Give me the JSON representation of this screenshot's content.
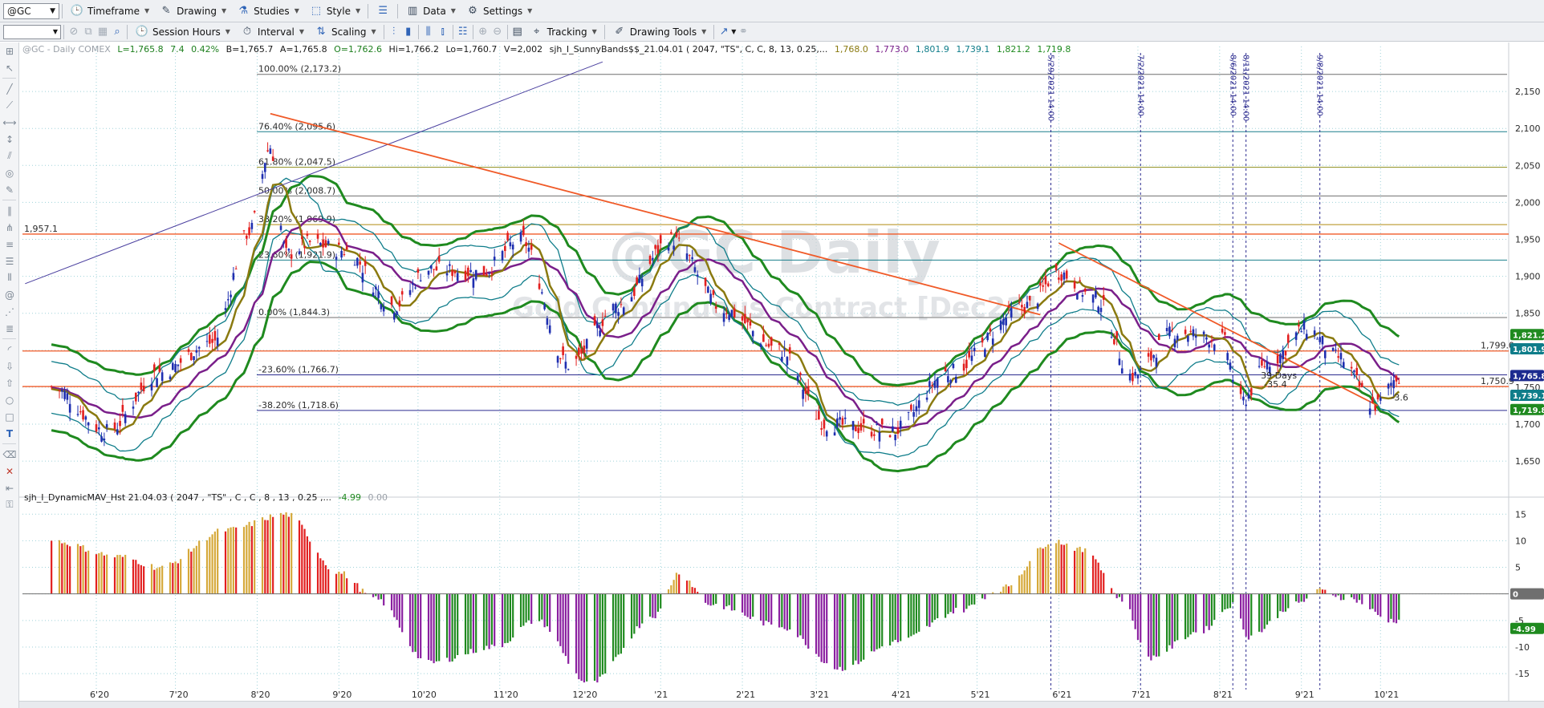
{
  "toolbar": {
    "symbol": "@GC",
    "timeframe": "Timeframe",
    "drawing": "Drawing",
    "studies": "Studies",
    "style": "Style",
    "data": "Data",
    "settings": "Settings",
    "session_hours": "Session Hours",
    "interval": "Interval",
    "scaling": "Scaling",
    "tracking": "Tracking",
    "drawing_tools": "Drawing Tools"
  },
  "legend": {
    "header": "@GC - Daily  COMEX",
    "L": "L=1,765.8",
    "chg": "7.4",
    "pct": "0.42%",
    "B": "B=1,765.7",
    "A": "A=1,765.8",
    "O": "O=1,762.6",
    "Hi": "Hi=1,766.2",
    "Lo": "Lo=1,760.7",
    "V": "V=2,002",
    "study": "sjh_I_SunnyBands$$_21.04.01 (  2047, \"TS\",  C,  C,    8,  13,  0.25,...",
    "v1": "1,768.0",
    "v2": "1,773.0",
    "v3": "1,801.9",
    "v4": "1,739.1",
    "v5": "1,821.2",
    "v6": "1,719.8"
  },
  "watermark": {
    "line1": "@GC Daily",
    "line2": "Gold Continuous Contract [Dec21]"
  },
  "fib_labels": [
    {
      "text": "100.00% (2,173.2)",
      "color": "#6f6f6f",
      "price": 2173.2
    },
    {
      "text": "76.40% (2,095.6)",
      "color": "#1a7f8c",
      "price": 2095.6
    },
    {
      "text": "61.80% (2,047.5)",
      "color": "#8c8c1a",
      "price": 2047.5
    },
    {
      "text": "50.00% (2,008.7)",
      "color": "#6f6f6f",
      "price": 2008.7
    },
    {
      "text": "38.20% (1,969.9)",
      "color": "#b08a12",
      "price": 1969.9
    },
    {
      "text": "23.60% (1,921.9)",
      "color": "#1a7f8c",
      "price": 1921.9
    },
    {
      "text": "0.00% (1,844.3)",
      "color": "#6f6f6f",
      "price": 1844.3
    },
    {
      "text": "-23.60% (1,766.7)",
      "color": "#2b2b8f",
      "price": 1766.7
    },
    {
      "text": "-38.20% (1,718.6)",
      "color": "#2b2b8f",
      "price": 1718.6
    }
  ],
  "hlines": [
    {
      "label": "1,957.1",
      "price": 1957.1,
      "color": "#f05a28"
    },
    {
      "label": "1,799.0",
      "price": 1799.0,
      "color": "#f05a28"
    },
    {
      "label": "1,750.9",
      "price": 1750.9,
      "color": "#f05a28"
    }
  ],
  "vlines": [
    {
      "label": "5/29/2021 14:00",
      "date": "2021-05-29"
    },
    {
      "label": "7/2/2021 14:00",
      "date": "2021-07-02"
    },
    {
      "label": "8/6/2021 14:00",
      "date": "2021-08-06"
    },
    {
      "label": "8/11/2021 14:00",
      "date": "2021-08-11"
    },
    {
      "label": "9/8/2021 14:00",
      "date": "2021-09-08"
    }
  ],
  "annotations": {
    "days": "39 Days",
    "delta": "-35.4",
    "delta2": "-3.6"
  },
  "price_tags": [
    {
      "text": "1,821.2",
      "price": 1821.2,
      "color": "#1f8a1f"
    },
    {
      "text": "1,801.9",
      "price": 1801.9,
      "color": "#0f7d8a"
    },
    {
      "text": "1,765.8",
      "price": 1765.8,
      "color": "#1c2b8f"
    },
    {
      "text": "1,739.1",
      "price": 1739.1,
      "color": "#0f7d8a"
    },
    {
      "text": "1,719.8",
      "price": 1719.8,
      "color": "#1f8a1f"
    }
  ],
  "osc": {
    "title": "sjh_I_DynamicMAV_Hst 21.04.03 ( 2047 , \"TS\" , C , C ,  8 , 13 , 0.25 ,...",
    "value": "-4.99",
    "value2": "0.00",
    "tag_zero": "0",
    "tag_val": "-4.99"
  },
  "chart_data": {
    "type": "candlestick",
    "title": "@GC Daily",
    "price_axis": {
      "ylim": [
        1610,
        2200
      ],
      "ticks": [
        "2,150",
        "2,100",
        "2,050",
        "2,000",
        "1,950",
        "1,900",
        "1,850",
        "1,800",
        "1,750",
        "1,700",
        "1,650"
      ]
    },
    "osc_axis": {
      "ylim": [
        -18,
        17
      ],
      "ticks": [
        "15",
        "10",
        "5",
        "0",
        "-5",
        "-10",
        "-15"
      ]
    },
    "x_ticks": [
      "6'20",
      "7'20",
      "8'20",
      "9'20",
      "10'20",
      "11'20",
      "12'20",
      "'21",
      "2'21",
      "3'21",
      "4'21",
      "5'21",
      "6'21",
      "7'21",
      "8'21",
      "9'21",
      "10'21"
    ],
    "price_path_anchors": [
      [
        "2020-05-15",
        1750
      ],
      [
        "2020-06-05",
        1690
      ],
      [
        "2020-06-25",
        1770
      ],
      [
        "2020-07-15",
        1810
      ],
      [
        "2020-07-29",
        1960
      ],
      [
        "2020-08-06",
        2075
      ],
      [
        "2020-08-12",
        1930
      ],
      [
        "2020-08-21",
        1945
      ],
      [
        "2020-09-03",
        1935
      ],
      [
        "2020-09-22",
        1860
      ],
      [
        "2020-10-05",
        1910
      ],
      [
        "2020-10-25",
        1905
      ],
      [
        "2020-11-09",
        1950
      ],
      [
        "2020-11-27",
        1780
      ],
      [
        "2020-12-16",
        1860
      ],
      [
        "2021-01-05",
        1950
      ],
      [
        "2021-01-25",
        1855
      ],
      [
        "2021-02-15",
        1800
      ],
      [
        "2021-03-05",
        1700
      ],
      [
        "2021-03-30",
        1690
      ],
      [
        "2021-04-20",
        1770
      ],
      [
        "2021-05-20",
        1860
      ],
      [
        "2021-06-01",
        1905
      ],
      [
        "2021-06-15",
        1870
      ],
      [
        "2021-06-29",
        1765
      ],
      [
        "2021-07-15",
        1825
      ],
      [
        "2021-08-02",
        1815
      ],
      [
        "2021-08-09",
        1730
      ],
      [
        "2021-08-20",
        1785
      ],
      [
        "2021-09-03",
        1830
      ],
      [
        "2021-09-15",
        1790
      ],
      [
        "2021-09-29",
        1725
      ],
      [
        "2021-10-08",
        1765
      ]
    ],
    "osc_anchors": [
      [
        "2020-05-15",
        10
      ],
      [
        "2020-06-10",
        7
      ],
      [
        "2020-06-25",
        5
      ],
      [
        "2020-07-20",
        12
      ],
      [
        "2020-08-12",
        15
      ],
      [
        "2020-09-01",
        4
      ],
      [
        "2020-09-15",
        -1
      ],
      [
        "2020-10-05",
        -13
      ],
      [
        "2020-10-30",
        -10
      ],
      [
        "2020-11-15",
        -5
      ],
      [
        "2020-12-05",
        -17
      ],
      [
        "2020-12-30",
        -4
      ],
      [
        "2021-01-08",
        4
      ],
      [
        "2021-01-20",
        -2
      ],
      [
        "2021-02-15",
        -6
      ],
      [
        "2021-03-10",
        -14
      ],
      [
        "2021-04-01",
        -9
      ],
      [
        "2021-04-25",
        -3
      ],
      [
        "2021-05-10",
        1
      ],
      [
        "2021-05-30",
        10
      ],
      [
        "2021-06-12",
        8
      ],
      [
        "2021-06-25",
        -1
      ],
      [
        "2021-07-05",
        -12
      ],
      [
        "2021-07-25",
        -7
      ],
      [
        "2021-08-06",
        -2
      ],
      [
        "2021-08-12",
        -8
      ],
      [
        "2021-08-30",
        -2
      ],
      [
        "2021-09-08",
        0.6
      ],
      [
        "2021-09-20",
        -1
      ],
      [
        "2021-10-05",
        -5
      ]
    ],
    "trendlines": [
      {
        "from": [
          "2020-05-05",
          1890
        ],
        "to": [
          "2020-12-10",
          2190
        ],
        "color": "#4a3f9f"
      },
      {
        "from": [
          "2020-08-06",
          2120
        ],
        "to": [
          "2021-05-25",
          1848
        ],
        "color": "#f05a28"
      },
      {
        "from": [
          "2021-06-01",
          1945
        ],
        "to": [
          "2021-09-30",
          1725
        ],
        "color": "#f05a28"
      }
    ]
  }
}
